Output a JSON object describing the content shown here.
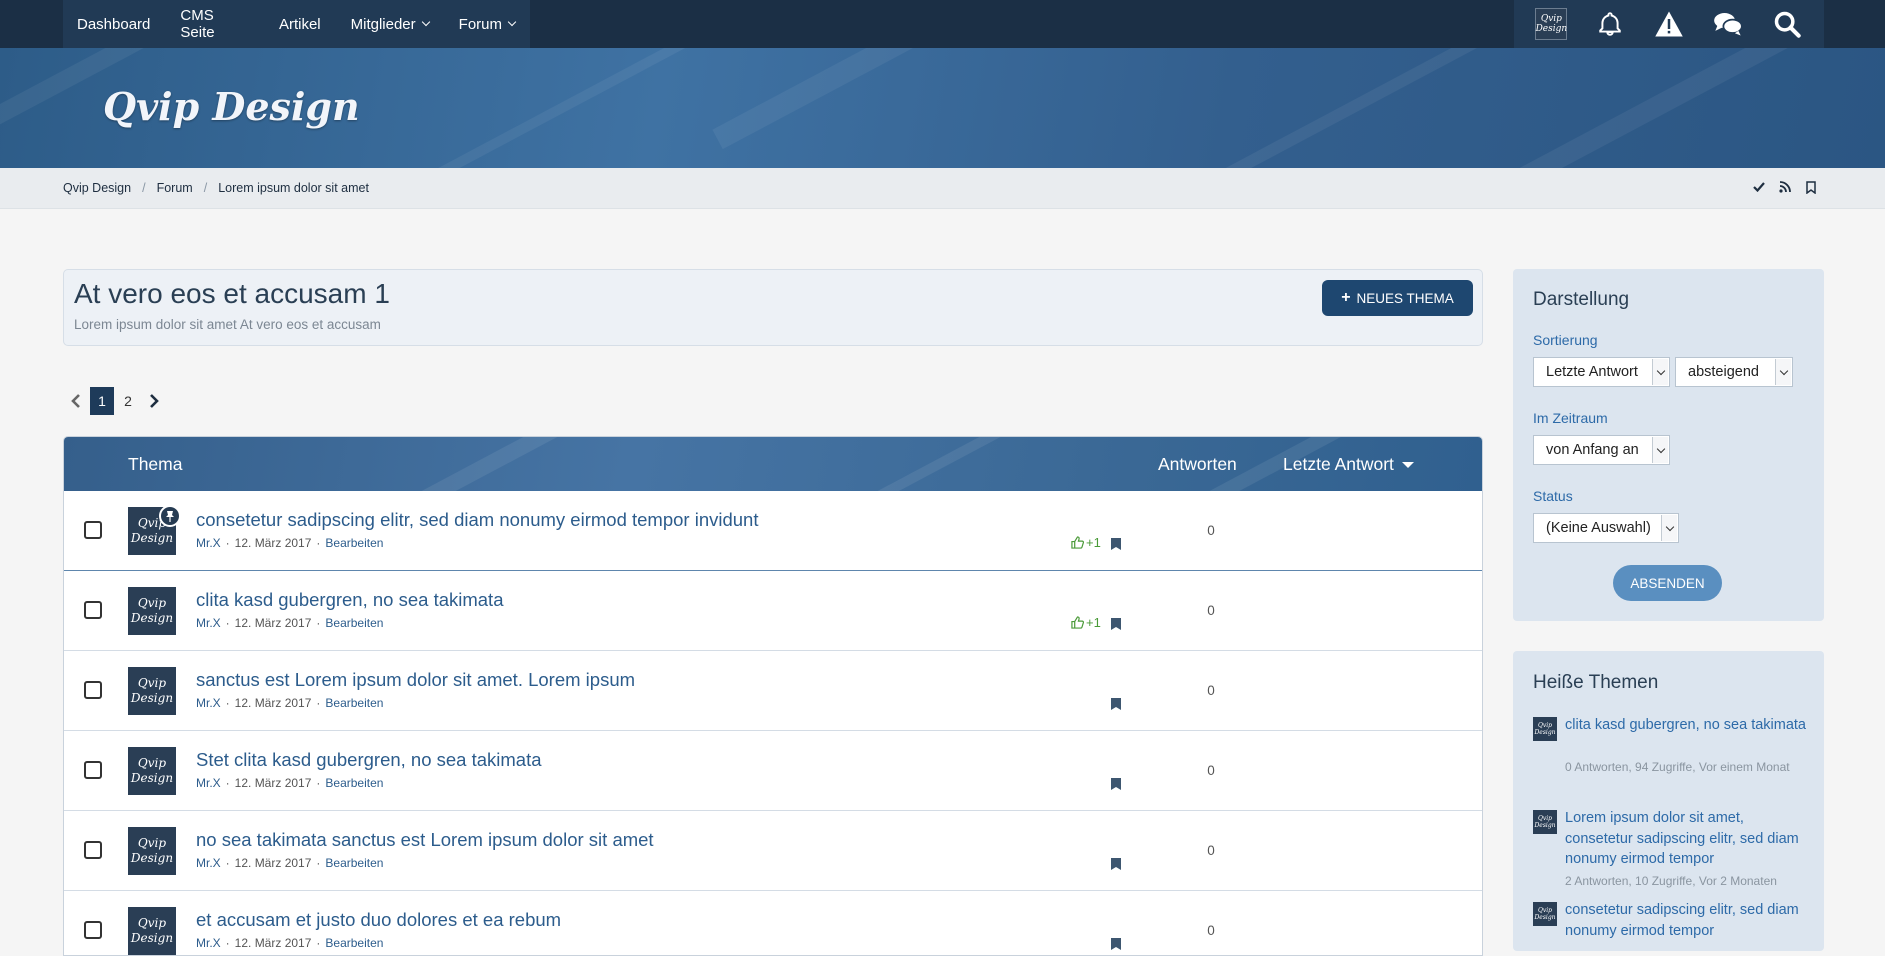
{
  "nav": {
    "items": [
      {
        "label": "Dashboard"
      },
      {
        "label": "CMS Seite"
      },
      {
        "label": "Artikel"
      },
      {
        "label": "Mitglieder"
      },
      {
        "label": "Forum"
      }
    ],
    "icons": [
      "user-avatar",
      "bell-icon",
      "warning-icon",
      "chat-icon",
      "search-icon"
    ],
    "avatar_text": "Qvip Design"
  },
  "header": {
    "logo": "Qvip Design"
  },
  "breadcrumb": {
    "items": [
      "Qvip Design",
      "Forum",
      "Lorem ipsum dolor sit amet"
    ],
    "actions": [
      "check-icon",
      "rss-icon",
      "bookmark-icon"
    ]
  },
  "board": {
    "title": "At vero eos et accusam 1",
    "subtitle": "Lorem ipsum dolor sit amet At vero eos et accusam",
    "new_topic_label": "NEUES THEMA"
  },
  "pagination": {
    "pages": [
      "1",
      "2"
    ],
    "current": "1"
  },
  "table": {
    "headers": {
      "topic": "Thema",
      "replies": "Antworten",
      "last_reply": "Letzte Antwort"
    },
    "rows": [
      {
        "title": "consetetur sadipscing elitr, sed diam nonumy eirmod tempor invidunt",
        "author": "Mr.X",
        "date": "12. März 2017",
        "edit": "Bearbeiten",
        "likes": "+1",
        "replies": "0",
        "pinned": true
      },
      {
        "title": "clita kasd gubergren, no sea takimata",
        "author": "Mr.X",
        "date": "12. März 2017",
        "edit": "Bearbeiten",
        "likes": "+1",
        "replies": "0",
        "pinned": false
      },
      {
        "title": "sanctus est Lorem ipsum dolor sit amet. Lorem ipsum",
        "author": "Mr.X",
        "date": "12. März 2017",
        "edit": "Bearbeiten",
        "likes": "",
        "replies": "0",
        "pinned": false
      },
      {
        "title": "Stet clita kasd gubergren, no sea takimata",
        "author": "Mr.X",
        "date": "12. März 2017",
        "edit": "Bearbeiten",
        "likes": "",
        "replies": "0",
        "pinned": false
      },
      {
        "title": "no sea takimata sanctus est Lorem ipsum dolor sit amet",
        "author": "Mr.X",
        "date": "12. März 2017",
        "edit": "Bearbeiten",
        "likes": "",
        "replies": "0",
        "pinned": false
      },
      {
        "title": "et accusam et justo duo dolores et ea rebum",
        "author": "Mr.X",
        "date": "12. März 2017",
        "edit": "Bearbeiten",
        "likes": "",
        "replies": "0",
        "pinned": false
      }
    ]
  },
  "sidebar": {
    "display": {
      "title": "Darstellung",
      "sort_label": "Sortierung",
      "sort_field": "Letzte Antwort",
      "sort_order": "absteigend",
      "period_label": "Im Zeitraum",
      "period": "von Anfang an",
      "status_label": "Status",
      "status": "(Keine Auswahl)",
      "submit_label": "ABSENDEN"
    },
    "hot": {
      "title": "Heiße Themen",
      "items": [
        {
          "title": "clita kasd gubergren, no sea takimata",
          "meta": "0 Antworten, 94 Zugriffe, Vor einem Monat"
        },
        {
          "title": "Lorem ipsum dolor sit amet, consetetur sadipscing elitr, sed diam nonumy eirmod tempor",
          "meta": "2 Antworten, 10 Zugriffe, Vor 2 Monaten"
        },
        {
          "title": "consetetur sadipscing elitr, sed diam nonumy eirmod tempor",
          "meta": ""
        }
      ]
    }
  },
  "colors": {
    "nav_bg": "#1b2f45",
    "accent": "#1e4770",
    "link": "#2c5c8c",
    "like": "#4a9a38"
  }
}
